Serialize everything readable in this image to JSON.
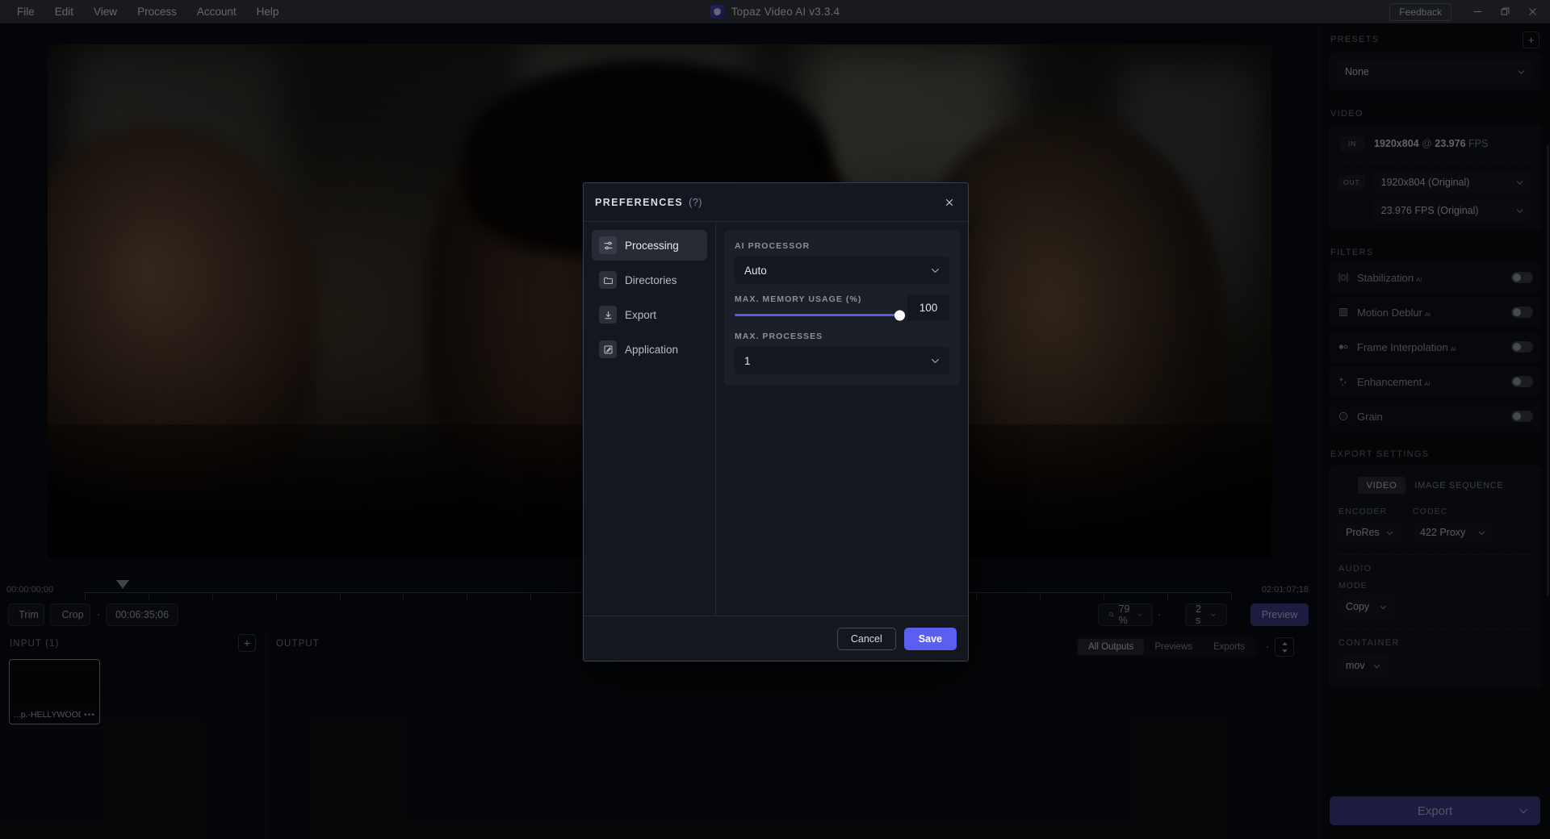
{
  "titlebar": {
    "menus": [
      "File",
      "Edit",
      "View",
      "Process",
      "Account",
      "Help"
    ],
    "app_title": "Topaz Video AI  v3.3.4",
    "feedback_label": "Feedback",
    "minimize": "minimize-icon",
    "maximize": "restore-icon",
    "close": "close-icon"
  },
  "timeline": {
    "start_time": "00:00:00;00",
    "end_time": "02:01:07;18",
    "trim_label": "Trim",
    "crop_label": "Crop",
    "duration_value": "00:06:35;06",
    "zoom_value": "79 %",
    "interval_value": "2 s",
    "preview_label": "Preview"
  },
  "input_panel": {
    "header": "INPUT (1)",
    "add_label": "+",
    "file_name": "...p.-HELLYWOOD.mkv",
    "more_label": "•••"
  },
  "output_panel": {
    "header": "OUTPUT",
    "tabs": [
      {
        "label": "All Outputs",
        "active": true
      },
      {
        "label": "Previews",
        "active": false
      },
      {
        "label": "Exports",
        "active": false
      }
    ]
  },
  "sidebar": {
    "presets": {
      "title": "PRESETS",
      "add_label": "+",
      "value": "None"
    },
    "video": {
      "title": "VIDEO",
      "in_badge": "IN",
      "in_text": "1920x804 @ 23.976 FPS",
      "in_res": "1920x804",
      "in_fps": "23.976",
      "in_at": "@",
      "in_fps_label": "FPS",
      "out_badge": "OUT",
      "out_resolution": "1920x804 (Original)",
      "out_res_bold": "1920x804",
      "out_res_rest": "(Original)",
      "out_fps": "23.976 FPS (Original)"
    },
    "filters": {
      "title": "FILTERS",
      "items": [
        {
          "label": "Stabilization",
          "ai": "AI",
          "icon": "stabilization-icon",
          "enabled": false
        },
        {
          "label": "Motion Deblur",
          "ai": "AI",
          "icon": "motion-deblur-icon",
          "enabled": false
        },
        {
          "label": "Frame Interpolation",
          "ai": "AI",
          "icon": "frame-interpolation-icon",
          "enabled": false
        },
        {
          "label": "Enhancement",
          "ai": "AI",
          "icon": "enhancement-icon",
          "enabled": false
        },
        {
          "label": "Grain",
          "ai": "",
          "icon": "grain-icon",
          "enabled": false
        }
      ]
    },
    "export_settings": {
      "title": "EXPORT SETTINGS",
      "mode_tabs": [
        {
          "label": "VIDEO",
          "active": true
        },
        {
          "label": "IMAGE SEQUENCE",
          "active": false
        }
      ],
      "encoder_label": "ENCODER",
      "encoder_value": "ProRes",
      "codec_label": "CODEC",
      "codec_value": "422 Proxy",
      "audio_title": "AUDIO",
      "mode_label": "MODE",
      "mode_value": "Copy",
      "container_label": "CONTAINER",
      "container_value": "mov"
    },
    "export_button": "Export"
  },
  "modal": {
    "title": "PREFERENCES",
    "help": "(?)",
    "close": "close-icon",
    "nav": [
      {
        "label": "Processing",
        "icon": "sliders-icon",
        "active": true
      },
      {
        "label": "Directories",
        "icon": "folder-icon",
        "active": false
      },
      {
        "label": "Export",
        "icon": "download-icon",
        "active": false
      },
      {
        "label": "Application",
        "icon": "app-edit-icon",
        "active": false
      }
    ],
    "ai_processor_label": "AI PROCESSOR",
    "ai_processor_value": "Auto",
    "memory_label": "MAX. MEMORY USAGE (%)",
    "memory_value": "100",
    "processes_label": "MAX. PROCESSES",
    "processes_value": "1",
    "cancel_label": "Cancel",
    "save_label": "Save"
  },
  "colors": {
    "accent": "#5b5ef0",
    "titlebar": "#353b48",
    "panel": "#0a0c10",
    "modal": "#14171e"
  }
}
